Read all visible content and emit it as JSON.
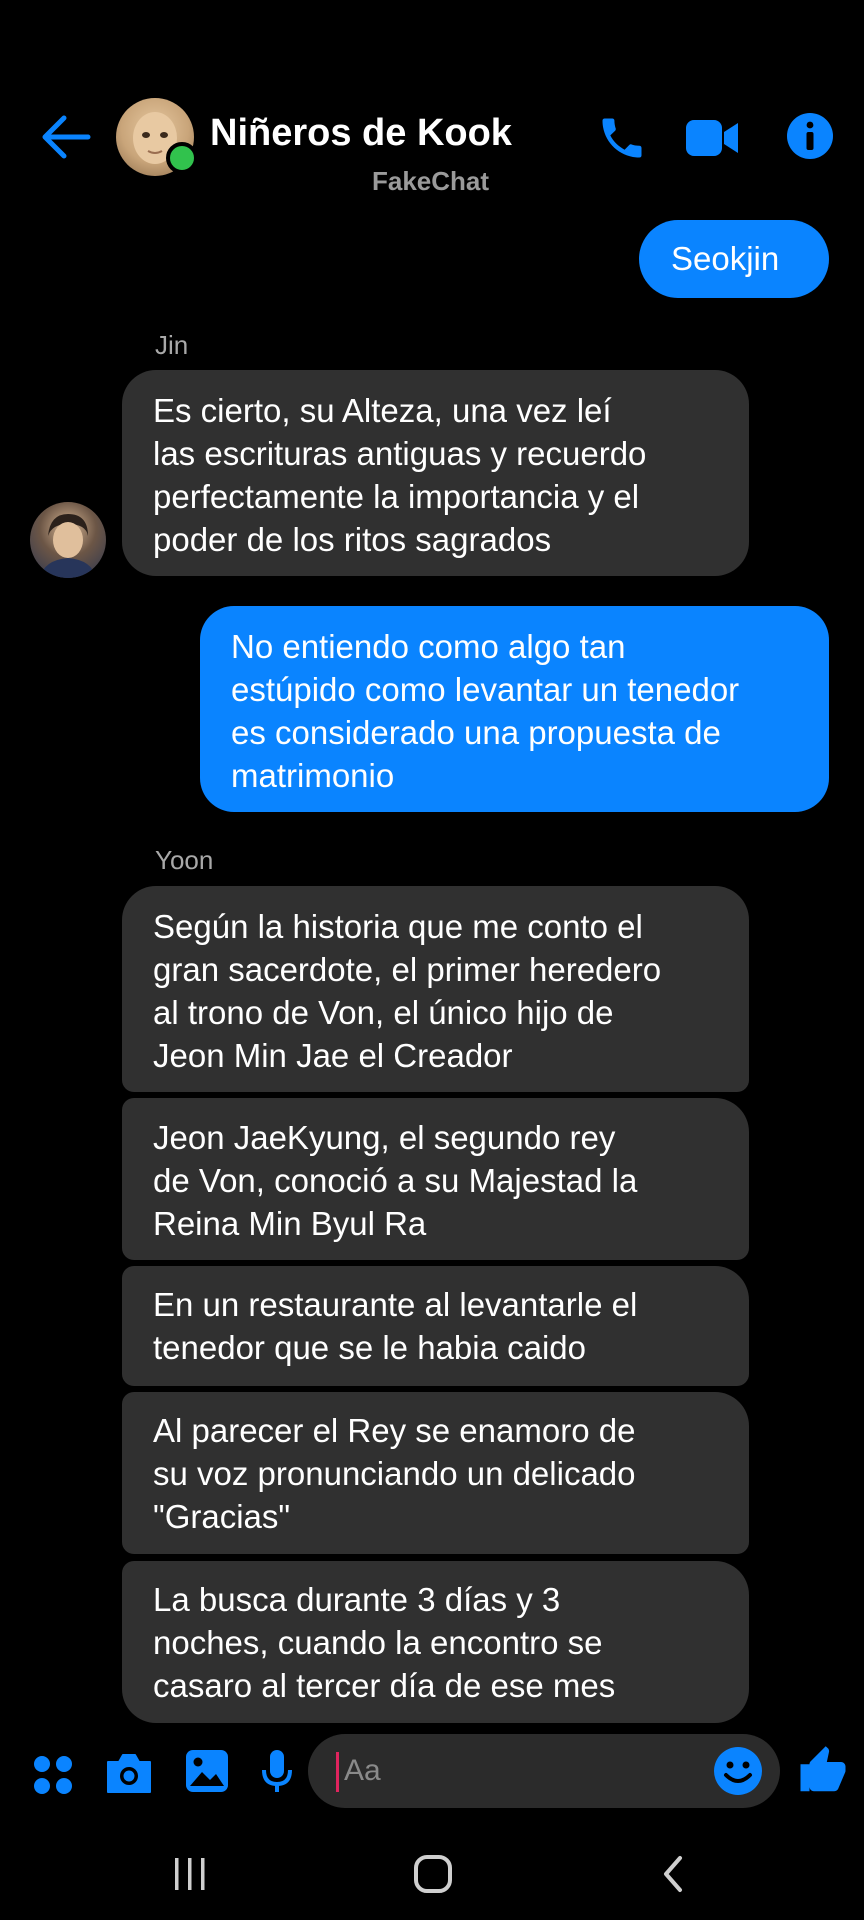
{
  "header": {
    "chat_name": "Niñeros de Kook",
    "subtitle": "FakeChat",
    "icons": [
      "back-arrow-icon",
      "phone-icon",
      "video-camera-icon",
      "info-icon"
    ],
    "online": true
  },
  "messages": [
    {
      "side": "me",
      "text": "Seokjin"
    },
    {
      "side": "them",
      "sender": "Jin",
      "text": "Es cierto, su Alteza, una vez leí\nlas escrituras antiguas y recuerdo\nperfectamente la importancia y el\npoder de los ritos sagrados"
    },
    {
      "side": "me",
      "text": "No entiendo como algo tan\nestúpido como levantar un tenedor\nes considerado una propuesta de\nmatrimonio"
    },
    {
      "side": "them",
      "sender": "Yoon",
      "text": "Según la historia que me conto el\ngran sacerdote, el primer heredero\nal trono de Von, el único hijo de\nJeon Min Jae el Creador"
    },
    {
      "side": "them",
      "text": "Jeon JaeKyung, el segundo rey\nde Von, conoció a su Majestad la\nReina Min Byul Ra"
    },
    {
      "side": "them",
      "text": "En un restaurante al levantarle el\ntenedor que se le habia caido"
    },
    {
      "side": "them",
      "text": "Al parecer el Rey se enamoro de\nsu voz pronunciando un delicado\n\"Gracias\""
    },
    {
      "side": "them",
      "text": "La busca durante 3 días y 3\nnoches, cuando la encontro se\ncasaro al tercer día de ese mes"
    }
  ],
  "composer": {
    "placeholder": "Aa",
    "icons": [
      "apps-grid-icon",
      "camera-icon",
      "gallery-icon",
      "microphone-icon",
      "emoji-icon",
      "thumbs-up-icon"
    ]
  },
  "colors": {
    "accent": "#0a84ff",
    "incoming_bubble": "#303030",
    "background": "#000000",
    "online": "#31c24d"
  }
}
